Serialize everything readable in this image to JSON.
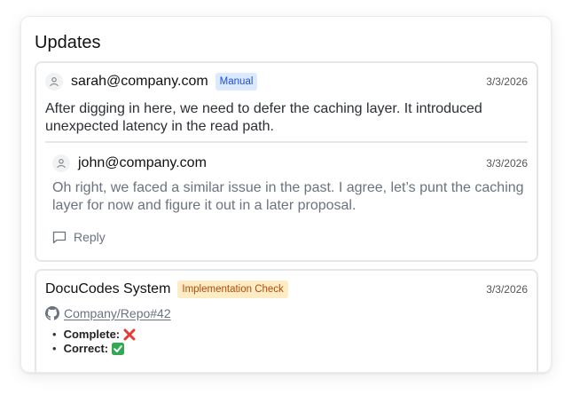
{
  "panel": {
    "title": "Updates"
  },
  "comment": {
    "author": "sarah@company.com",
    "badge": "Manual",
    "date": "3/3/2026",
    "text": "After digging in here, we need to defer the caching layer. It introduced unexpected latency in the read path."
  },
  "reply": {
    "author": "john@company.com",
    "date": "3/3/2026",
    "text": "Oh right, we faced a similar issue in the past. I agree, let’s punt the caching layer for now and figure it out in a later proposal."
  },
  "reply_button": {
    "label": "Reply",
    "icon": "comment-icon"
  },
  "system_update": {
    "author": "DocuCodes System",
    "badge": "Implementation Check",
    "date": "3/3/2026",
    "repo_link": "Company/Repo#42",
    "repo_icon": "github-icon",
    "checks": [
      {
        "label": "Complete:",
        "status": "fail",
        "icon": "cross-mark-icon"
      },
      {
        "label": "Correct:",
        "status": "pass",
        "icon": "check-mark-icon"
      }
    ]
  },
  "colors": {
    "manual_badge_bg": "#dbeafe",
    "manual_badge_text": "#1d4ed8",
    "check_badge_bg": "#fdecc4",
    "check_badge_text": "#b4490a",
    "fail": "#e53935",
    "pass": "#34a853"
  }
}
